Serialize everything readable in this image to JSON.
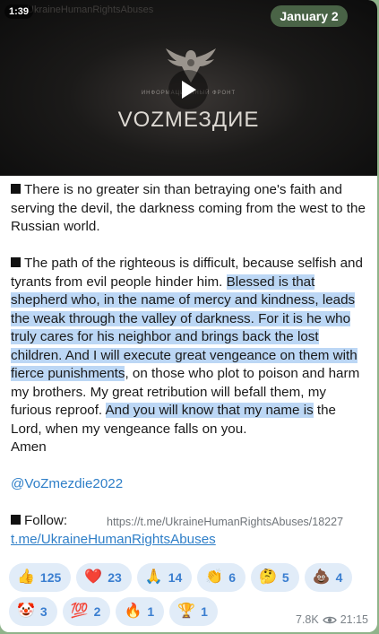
{
  "video": {
    "duration": "1:39",
    "watermark": "UkraineHumanRightsAbuses",
    "date_badge": "January 2",
    "logo_small_text": "ИНФОРМАЦИОННЫЙ ФРОНТ",
    "logo_title": "VOZМЕЗДИЕ"
  },
  "message": {
    "para1": "There is no greater sin than betraying one's faith and serving the devil, the darkness coming from the west to the Russian world.",
    "para2_a": "The path of the righteous is difficult, because selfish and tyrants from evil people hinder him. ",
    "para2_hl1": "Blessed is that shepherd who, in the name of mercy and kindness, leads the weak through the valley of darkness. For it is he who truly cares for his neighbor and brings back the lost children. And I will execute great vengeance on them with fierce punishments",
    "para2_b": ", on those who plot to poison and harm my brothers. My great retribution will befall them, my furious reproof. ",
    "para2_hl2": "And you will know that my name is",
    "para2_c": " the Lord, when my vengeance falls on you.",
    "amen": "Amen",
    "handle": "@VoZmezdie2022",
    "follow_label": "Follow:",
    "follow_source": "https://t.me/UkraineHumanRightsAbuses/18227",
    "follow_link": "t.me/UkraineHumanRightsAbuses"
  },
  "reactions": [
    {
      "emoji": "👍",
      "count": "125"
    },
    {
      "emoji": "❤️",
      "count": "23"
    },
    {
      "emoji": "🙏",
      "count": "14"
    },
    {
      "emoji": "👏",
      "count": "6"
    },
    {
      "emoji": "🤔",
      "count": "5"
    },
    {
      "emoji": "💩",
      "count": "4"
    },
    {
      "emoji": "🤡",
      "count": "3"
    },
    {
      "emoji": "💯",
      "count": "2"
    },
    {
      "emoji": "🔥",
      "count": "1"
    },
    {
      "emoji": "🏆",
      "count": "1"
    }
  ],
  "footer": {
    "views": "7.8K",
    "time": "21:15"
  },
  "colors": {
    "background": "#8fb38a",
    "link": "#2f7fc8",
    "highlight": "#bcd7f5",
    "reaction_bg": "#e1ecf8"
  }
}
